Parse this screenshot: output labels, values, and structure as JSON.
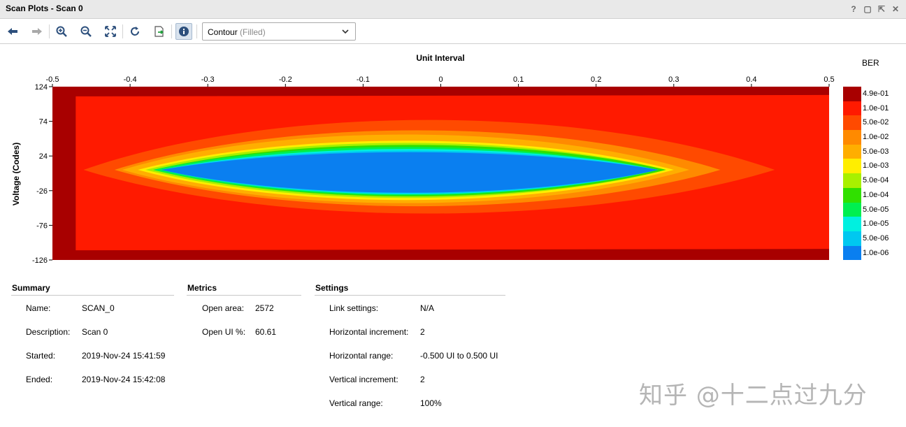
{
  "window": {
    "title": "Scan Plots - Scan 0",
    "controls": [
      "?",
      "▢",
      "⇱",
      "✕"
    ]
  },
  "toolbar": {
    "plot_type": "Contour",
    "plot_type_suffix": "(Filled)"
  },
  "chart_data": {
    "type": "heatmap",
    "subtype": "filled-contour",
    "title": "",
    "xlabel": "Unit Interval",
    "ylabel": "Voltage (Codes)",
    "x_axis_position": "top",
    "xlim": [
      -0.5,
      0.5
    ],
    "ylim": [
      -126,
      124
    ],
    "x_ticks": [
      "-0.5",
      "-0.4",
      "-0.3",
      "-0.2",
      "-0.1",
      "0",
      "0.1",
      "0.2",
      "0.3",
      "0.4",
      "0.5"
    ],
    "y_ticks": [
      "124",
      "74",
      "24",
      "-26",
      "-76",
      "-126"
    ],
    "colorbar_title": "BER",
    "levels": [
      {
        "label": "4.9e-01",
        "color": "#a80000"
      },
      {
        "label": "1.0e-01",
        "color": "#ff1a00"
      },
      {
        "label": "5.0e-02",
        "color": "#ff4a00"
      },
      {
        "label": "1.0e-02",
        "color": "#ff8a00"
      },
      {
        "label": "5.0e-03",
        "color": "#ffae00"
      },
      {
        "label": "1.0e-03",
        "color": "#ffee00"
      },
      {
        "label": "5.0e-04",
        "color": "#a8f000"
      },
      {
        "label": "1.0e-04",
        "color": "#30e000"
      },
      {
        "label": "5.0e-05",
        "color": "#00ef50"
      },
      {
        "label": "1.0e-05",
        "color": "#00f0e0"
      },
      {
        "label": "5.0e-06",
        "color": "#00c8f0"
      },
      {
        "label": "1.0e-06",
        "color": "#0a7ff0"
      }
    ],
    "eye_contours": [
      {
        "level": "1.0e-01",
        "x_range": [
          -0.47,
          0.5
        ],
        "y_range": [
          -112,
          112
        ]
      },
      {
        "level": "5.0e-02",
        "x_range": [
          -0.46,
          0.43
        ],
        "y_range": [
          -80,
          100
        ]
      },
      {
        "level": "1.0e-02",
        "x_range": [
          -0.42,
          0.36
        ],
        "y_range": [
          -66,
          80
        ]
      },
      {
        "level": "5.0e-03",
        "x_range": [
          -0.41,
          0.32
        ],
        "y_range": [
          -60,
          72
        ]
      },
      {
        "level": "1.0e-03",
        "x_range": [
          -0.39,
          0.3
        ],
        "y_range": [
          -54,
          60
        ]
      },
      {
        "level": "5.0e-04",
        "x_range": [
          -0.38,
          0.29
        ],
        "y_range": [
          -50,
          56
        ]
      },
      {
        "level": "1.0e-04",
        "x_range": [
          -0.37,
          0.29
        ],
        "y_range": [
          -47,
          52
        ]
      },
      {
        "level": "5.0e-05",
        "x_range": [
          -0.37,
          0.28
        ],
        "y_range": [
          -45,
          48
        ]
      },
      {
        "level": "1.0e-05",
        "x_range": [
          -0.36,
          0.28
        ],
        "y_range": [
          -43,
          44
        ]
      },
      {
        "level": "5.0e-06",
        "x_range": [
          -0.36,
          0.28
        ],
        "y_range": [
          -42,
          41
        ]
      },
      {
        "level": "1.0e-06",
        "x_range": [
          -0.36,
          0.28
        ],
        "y_range": [
          -40,
          38
        ]
      }
    ]
  },
  "summary": {
    "heading": "Summary",
    "rows": [
      {
        "key": "Name:",
        "value": "SCAN_0"
      },
      {
        "key": "Description:",
        "value": "Scan 0"
      },
      {
        "key": "Started:",
        "value": "2019-Nov-24 15:41:59"
      },
      {
        "key": "Ended:",
        "value": "2019-Nov-24 15:42:08"
      }
    ]
  },
  "metrics": {
    "heading": "Metrics",
    "rows": [
      {
        "key": "Open area:",
        "value": "2572"
      },
      {
        "key": "Open UI %:",
        "value": "60.61"
      }
    ]
  },
  "settings": {
    "heading": "Settings",
    "rows": [
      {
        "key": "Link settings:",
        "value": "N/A"
      },
      {
        "key": "Horizontal increment:",
        "value": "2"
      },
      {
        "key": "Horizontal range:",
        "value": "-0.500 UI to 0.500 UI"
      },
      {
        "key": "Vertical increment:",
        "value": "2"
      },
      {
        "key": "Vertical range:",
        "value": "100%"
      }
    ]
  },
  "watermark": "知乎 @十二点过九分"
}
